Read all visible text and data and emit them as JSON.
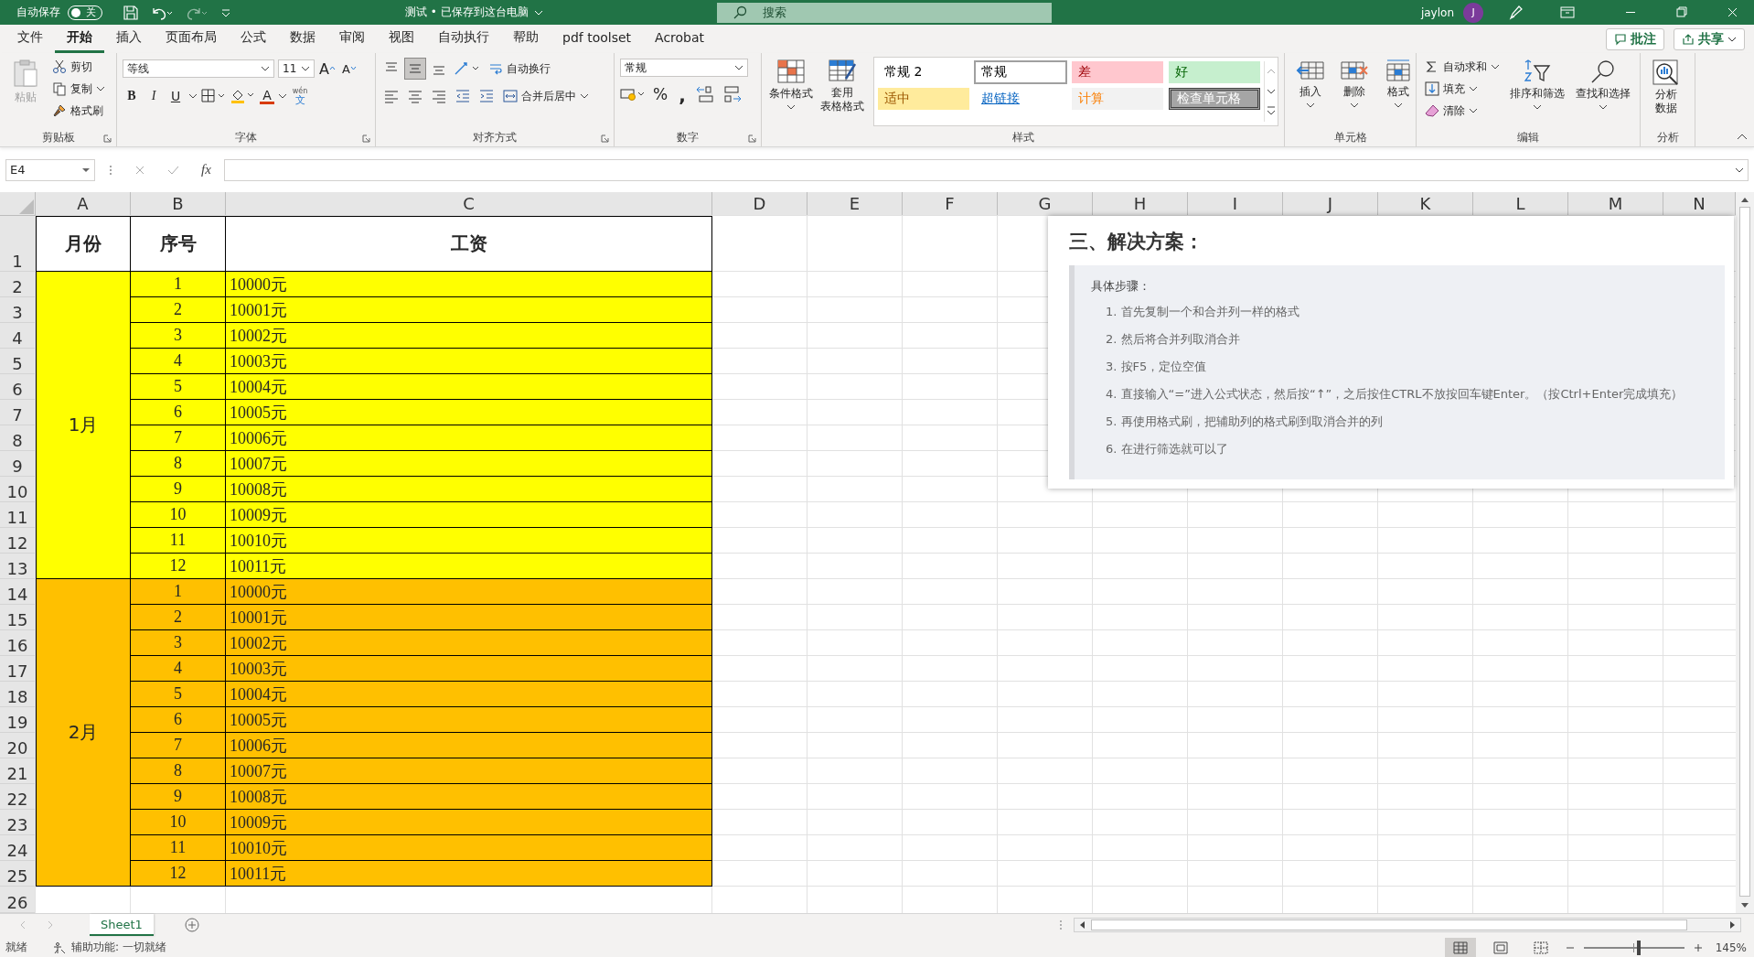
{
  "title_bar": {
    "autosave_label": "自动保存",
    "autosave": {
      "on": false,
      "label": "关"
    },
    "document_title": "测试 • 已保存到这台电脑",
    "search": {
      "placeholder": "搜索"
    },
    "user": "jaylon",
    "avatar": "J"
  },
  "menu_tabs": [
    {
      "label": "文件",
      "selected": false
    },
    {
      "label": "开始",
      "selected": true
    },
    {
      "label": "插入",
      "selected": false
    },
    {
      "label": "页面布局",
      "selected": false
    },
    {
      "label": "公式",
      "selected": false
    },
    {
      "label": "数据",
      "selected": false
    },
    {
      "label": "审阅",
      "selected": false
    },
    {
      "label": "视图",
      "selected": false
    },
    {
      "label": "自动执行",
      "selected": false
    },
    {
      "label": "帮助",
      "selected": false
    },
    {
      "label": "pdf toolset",
      "selected": false
    },
    {
      "label": "Acrobat",
      "selected": false
    }
  ],
  "comment_button": "批注",
  "share_button": "共享",
  "ribbon": {
    "clipboard": {
      "label": "剪贴板",
      "paste": "粘贴",
      "cut": "剪切",
      "copy": "复制",
      "format_painter": "格式刷"
    },
    "font": {
      "label": "字体",
      "font_name": "等线",
      "font_size": "11",
      "grow": "A",
      "shrink": "A",
      "bold": "B",
      "italic": "I",
      "underline": "U",
      "font_color": "A",
      "phonetic_ruby": "wén",
      "phonetic": "文"
    },
    "alignment": {
      "label": "对齐方式",
      "wrap_text": "自动换行",
      "merge_center": "合并后居中"
    },
    "number": {
      "label": "数字",
      "format": "常规",
      "percent": "%",
      "comma": ","
    },
    "styles": {
      "label": "样式",
      "conditional_formatting": "条件格式",
      "format_as_table": [
        "套用",
        "表格格式"
      ],
      "cell_styles": [
        {
          "label": "常规 2",
          "kind": "normal",
          "color": "#ffffff",
          "selected": false
        },
        {
          "label": "常规",
          "kind": "normal",
          "color": "#ffffff",
          "selected": true
        },
        {
          "label": "差",
          "kind": "bad",
          "color": "#ffc7ce",
          "selected": false
        },
        {
          "label": "好",
          "kind": "good",
          "color": "#c6efce",
          "selected": false
        },
        {
          "label": "适中",
          "kind": "neutral",
          "color": "#ffeb9c",
          "selected": false
        },
        {
          "label": "超链接",
          "kind": "link",
          "color": "#ffffff",
          "selected": false
        },
        {
          "label": "计算",
          "kind": "calc",
          "color": "#f2f2f2",
          "selected": false
        },
        {
          "label": "检查单元格",
          "kind": "check",
          "color": "#a5a5a5",
          "selected": false
        }
      ]
    },
    "cells": {
      "label": "单元格",
      "insert": "插入",
      "delete": "删除",
      "format": "格式"
    },
    "editing": {
      "label": "编辑",
      "autosum": "自动求和",
      "fill": "填充",
      "clear": "清除",
      "sort_filter": "排序和筛选",
      "find_select": "查找和选择"
    },
    "analysis": {
      "label": "分析",
      "analyze_data": [
        "分析",
        "数据"
      ]
    }
  },
  "formula_bar": {
    "name_box": "E4",
    "fx": "fx"
  },
  "sheet": {
    "columns": [
      "A",
      "B",
      "C",
      "D",
      "E",
      "F",
      "G",
      "H",
      "I",
      "J",
      "K",
      "L",
      "M",
      "N"
    ],
    "rows": [
      "1",
      "2",
      "3",
      "4",
      "5",
      "6",
      "7",
      "8",
      "9",
      "10",
      "11",
      "12",
      "13",
      "14",
      "15",
      "16",
      "17",
      "18",
      "19",
      "20",
      "21",
      "22",
      "23",
      "24",
      "25",
      "26"
    ],
    "headers": [
      "月份",
      "序号",
      "工资"
    ],
    "groups": [
      {
        "month": "1月",
        "color": "#ffff00",
        "rows": [
          {
            "seq": "1",
            "salary": "10000元"
          },
          {
            "seq": "2",
            "salary": "10001元"
          },
          {
            "seq": "3",
            "salary": "10002元"
          },
          {
            "seq": "4",
            "salary": "10003元"
          },
          {
            "seq": "5",
            "salary": "10004元"
          },
          {
            "seq": "6",
            "salary": "10005元"
          },
          {
            "seq": "7",
            "salary": "10006元"
          },
          {
            "seq": "8",
            "salary": "10007元"
          },
          {
            "seq": "9",
            "salary": "10008元"
          },
          {
            "seq": "10",
            "salary": "10009元"
          },
          {
            "seq": "11",
            "salary": "10010元"
          },
          {
            "seq": "12",
            "salary": "10011元"
          }
        ]
      },
      {
        "month": "2月",
        "color": "#ffc000",
        "rows": [
          {
            "seq": "1",
            "salary": "10000元"
          },
          {
            "seq": "2",
            "salary": "10001元"
          },
          {
            "seq": "3",
            "salary": "10002元"
          },
          {
            "seq": "4",
            "salary": "10003元"
          },
          {
            "seq": "5",
            "salary": "10004元"
          },
          {
            "seq": "6",
            "salary": "10005元"
          },
          {
            "seq": "7",
            "salary": "10006元"
          },
          {
            "seq": "8",
            "salary": "10007元"
          },
          {
            "seq": "9",
            "salary": "10008元"
          },
          {
            "seq": "10",
            "salary": "10009元"
          },
          {
            "seq": "11",
            "salary": "10010元"
          },
          {
            "seq": "12",
            "salary": "10011元"
          }
        ]
      }
    ]
  },
  "note_panel": {
    "title": "三、解决方案：",
    "subtitle": "具体步骤：",
    "steps": [
      "1. 首先复制一个和合并列一样的格式",
      "2. 然后将合并列取消合并",
      "3. 按F5，定位空值",
      "4. 直接输入“=”进入公式状态，然后按“↑”，之后按住CTRL不放按回车键Enter。（按Ctrl+Enter完成填充）",
      "5. 再使用格式刷，把辅助列的格式刷到取消合并的列",
      "6. 在进行筛选就可以了"
    ]
  },
  "sheet_tabs": [
    {
      "label": "Sheet1",
      "selected": true
    }
  ],
  "status_bar": {
    "status": "就绪",
    "accessibility": "辅助功能: 一切就绪",
    "views": [
      {
        "kind": "normal",
        "selected": true
      },
      {
        "kind": "page_layout",
        "selected": false
      },
      {
        "kind": "page_break",
        "selected": false
      }
    ],
    "zoom": {
      "level": 0.55,
      "reading": "145%"
    }
  }
}
